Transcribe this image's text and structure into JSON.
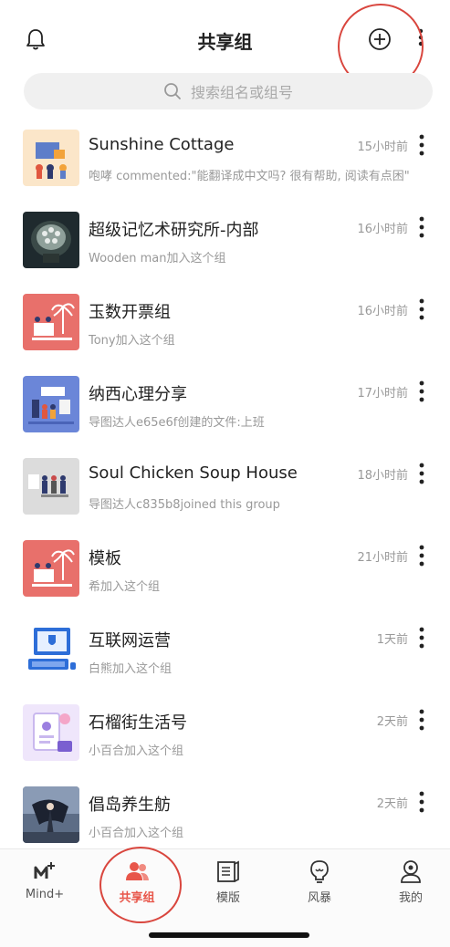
{
  "header": {
    "title": "共享组"
  },
  "search": {
    "placeholder": "搜索组名或组号"
  },
  "groups": [
    {
      "title": "Sunshine Cottage",
      "subtitle": "咆哮 commented:\"能翻译成中文吗? 很有帮助, 阅读有点困\"",
      "time": "15小时前"
    },
    {
      "title": "超级记忆术研究所-内部",
      "subtitle": "Wooden  man加入这个组",
      "time": "16小时前"
    },
    {
      "title": "玉数开票组",
      "subtitle": "Tony加入这个组",
      "time": "16小时前"
    },
    {
      "title": "纳西心理分享",
      "subtitle": "导图达人e65e6f创建的文件:上班",
      "time": "17小时前"
    },
    {
      "title": "Soul Chicken Soup House",
      "subtitle": "导图达人c835b8joined this group",
      "time": "18小时前"
    },
    {
      "title": "模板",
      "subtitle": "希加入这个组",
      "time": "21小时前"
    },
    {
      "title": "互联网运营",
      "subtitle": "白熊加入这个组",
      "time": "1天前"
    },
    {
      "title": "石榴街生活号",
      "subtitle": "小百合加入这个组",
      "time": "2天前"
    },
    {
      "title": "倡岛养生舫",
      "subtitle": "小百合加入这个组",
      "time": "2天前"
    }
  ],
  "tabs": [
    {
      "label": "Mind+",
      "icon": "mind-plus-icon"
    },
    {
      "label": "共享组",
      "icon": "group-icon"
    },
    {
      "label": "模版",
      "icon": "template-book-icon"
    },
    {
      "label": "风暴",
      "icon": "bulb-icon"
    },
    {
      "label": "我的",
      "icon": "profile-icon"
    }
  ],
  "colors": {
    "accent": "#e8564a",
    "annotation": "#d9463e"
  }
}
